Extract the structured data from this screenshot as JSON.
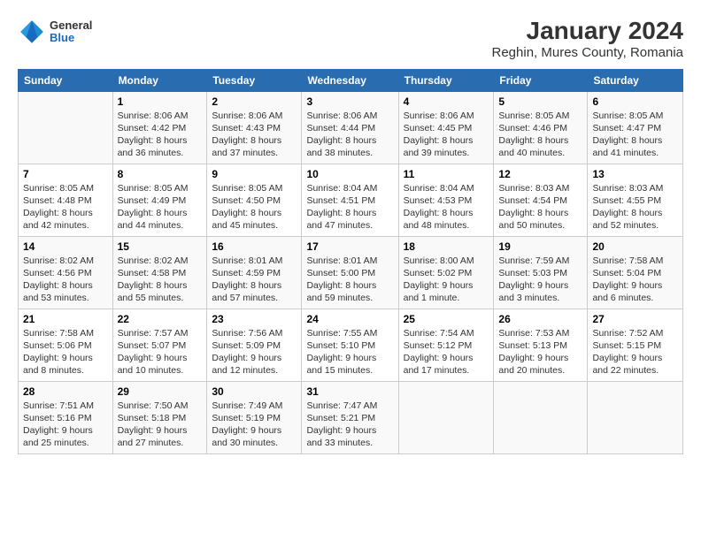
{
  "header": {
    "logo": {
      "general": "General",
      "blue": "Blue"
    },
    "title": "January 2024",
    "subtitle": "Reghin, Mures County, Romania"
  },
  "weekdays": [
    "Sunday",
    "Monday",
    "Tuesday",
    "Wednesday",
    "Thursday",
    "Friday",
    "Saturday"
  ],
  "weeks": [
    [
      {
        "day": "",
        "sunrise": "",
        "sunset": "",
        "daylight": ""
      },
      {
        "day": "1",
        "sunrise": "Sunrise: 8:06 AM",
        "sunset": "Sunset: 4:42 PM",
        "daylight": "Daylight: 8 hours and 36 minutes."
      },
      {
        "day": "2",
        "sunrise": "Sunrise: 8:06 AM",
        "sunset": "Sunset: 4:43 PM",
        "daylight": "Daylight: 8 hours and 37 minutes."
      },
      {
        "day": "3",
        "sunrise": "Sunrise: 8:06 AM",
        "sunset": "Sunset: 4:44 PM",
        "daylight": "Daylight: 8 hours and 38 minutes."
      },
      {
        "day": "4",
        "sunrise": "Sunrise: 8:06 AM",
        "sunset": "Sunset: 4:45 PM",
        "daylight": "Daylight: 8 hours and 39 minutes."
      },
      {
        "day": "5",
        "sunrise": "Sunrise: 8:05 AM",
        "sunset": "Sunset: 4:46 PM",
        "daylight": "Daylight: 8 hours and 40 minutes."
      },
      {
        "day": "6",
        "sunrise": "Sunrise: 8:05 AM",
        "sunset": "Sunset: 4:47 PM",
        "daylight": "Daylight: 8 hours and 41 minutes."
      }
    ],
    [
      {
        "day": "7",
        "sunrise": "Sunrise: 8:05 AM",
        "sunset": "Sunset: 4:48 PM",
        "daylight": "Daylight: 8 hours and 42 minutes."
      },
      {
        "day": "8",
        "sunrise": "Sunrise: 8:05 AM",
        "sunset": "Sunset: 4:49 PM",
        "daylight": "Daylight: 8 hours and 44 minutes."
      },
      {
        "day": "9",
        "sunrise": "Sunrise: 8:05 AM",
        "sunset": "Sunset: 4:50 PM",
        "daylight": "Daylight: 8 hours and 45 minutes."
      },
      {
        "day": "10",
        "sunrise": "Sunrise: 8:04 AM",
        "sunset": "Sunset: 4:51 PM",
        "daylight": "Daylight: 8 hours and 47 minutes."
      },
      {
        "day": "11",
        "sunrise": "Sunrise: 8:04 AM",
        "sunset": "Sunset: 4:53 PM",
        "daylight": "Daylight: 8 hours and 48 minutes."
      },
      {
        "day": "12",
        "sunrise": "Sunrise: 8:03 AM",
        "sunset": "Sunset: 4:54 PM",
        "daylight": "Daylight: 8 hours and 50 minutes."
      },
      {
        "day": "13",
        "sunrise": "Sunrise: 8:03 AM",
        "sunset": "Sunset: 4:55 PM",
        "daylight": "Daylight: 8 hours and 52 minutes."
      }
    ],
    [
      {
        "day": "14",
        "sunrise": "Sunrise: 8:02 AM",
        "sunset": "Sunset: 4:56 PM",
        "daylight": "Daylight: 8 hours and 53 minutes."
      },
      {
        "day": "15",
        "sunrise": "Sunrise: 8:02 AM",
        "sunset": "Sunset: 4:58 PM",
        "daylight": "Daylight: 8 hours and 55 minutes."
      },
      {
        "day": "16",
        "sunrise": "Sunrise: 8:01 AM",
        "sunset": "Sunset: 4:59 PM",
        "daylight": "Daylight: 8 hours and 57 minutes."
      },
      {
        "day": "17",
        "sunrise": "Sunrise: 8:01 AM",
        "sunset": "Sunset: 5:00 PM",
        "daylight": "Daylight: 8 hours and 59 minutes."
      },
      {
        "day": "18",
        "sunrise": "Sunrise: 8:00 AM",
        "sunset": "Sunset: 5:02 PM",
        "daylight": "Daylight: 9 hours and 1 minute."
      },
      {
        "day": "19",
        "sunrise": "Sunrise: 7:59 AM",
        "sunset": "Sunset: 5:03 PM",
        "daylight": "Daylight: 9 hours and 3 minutes."
      },
      {
        "day": "20",
        "sunrise": "Sunrise: 7:58 AM",
        "sunset": "Sunset: 5:04 PM",
        "daylight": "Daylight: 9 hours and 6 minutes."
      }
    ],
    [
      {
        "day": "21",
        "sunrise": "Sunrise: 7:58 AM",
        "sunset": "Sunset: 5:06 PM",
        "daylight": "Daylight: 9 hours and 8 minutes."
      },
      {
        "day": "22",
        "sunrise": "Sunrise: 7:57 AM",
        "sunset": "Sunset: 5:07 PM",
        "daylight": "Daylight: 9 hours and 10 minutes."
      },
      {
        "day": "23",
        "sunrise": "Sunrise: 7:56 AM",
        "sunset": "Sunset: 5:09 PM",
        "daylight": "Daylight: 9 hours and 12 minutes."
      },
      {
        "day": "24",
        "sunrise": "Sunrise: 7:55 AM",
        "sunset": "Sunset: 5:10 PM",
        "daylight": "Daylight: 9 hours and 15 minutes."
      },
      {
        "day": "25",
        "sunrise": "Sunrise: 7:54 AM",
        "sunset": "Sunset: 5:12 PM",
        "daylight": "Daylight: 9 hours and 17 minutes."
      },
      {
        "day": "26",
        "sunrise": "Sunrise: 7:53 AM",
        "sunset": "Sunset: 5:13 PM",
        "daylight": "Daylight: 9 hours and 20 minutes."
      },
      {
        "day": "27",
        "sunrise": "Sunrise: 7:52 AM",
        "sunset": "Sunset: 5:15 PM",
        "daylight": "Daylight: 9 hours and 22 minutes."
      }
    ],
    [
      {
        "day": "28",
        "sunrise": "Sunrise: 7:51 AM",
        "sunset": "Sunset: 5:16 PM",
        "daylight": "Daylight: 9 hours and 25 minutes."
      },
      {
        "day": "29",
        "sunrise": "Sunrise: 7:50 AM",
        "sunset": "Sunset: 5:18 PM",
        "daylight": "Daylight: 9 hours and 27 minutes."
      },
      {
        "day": "30",
        "sunrise": "Sunrise: 7:49 AM",
        "sunset": "Sunset: 5:19 PM",
        "daylight": "Daylight: 9 hours and 30 minutes."
      },
      {
        "day": "31",
        "sunrise": "Sunrise: 7:47 AM",
        "sunset": "Sunset: 5:21 PM",
        "daylight": "Daylight: 9 hours and 33 minutes."
      },
      {
        "day": "",
        "sunrise": "",
        "sunset": "",
        "daylight": ""
      },
      {
        "day": "",
        "sunrise": "",
        "sunset": "",
        "daylight": ""
      },
      {
        "day": "",
        "sunrise": "",
        "sunset": "",
        "daylight": ""
      }
    ]
  ]
}
